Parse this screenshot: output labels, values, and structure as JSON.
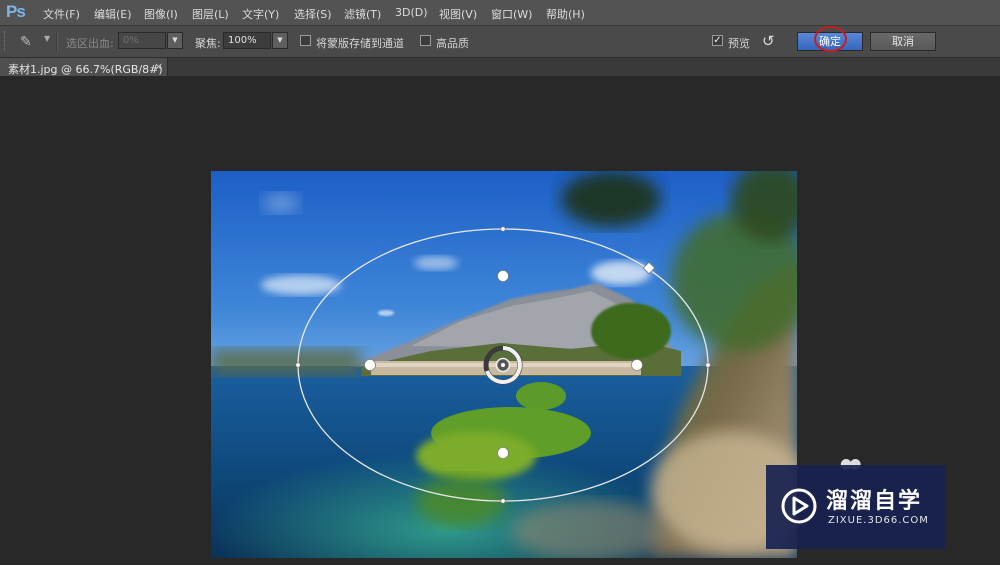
{
  "app": {
    "logo": "Ps"
  },
  "menu": [
    "文件(F)",
    "编辑(E)",
    "图像(I)",
    "图层(L)",
    "文字(Y)",
    "选择(S)",
    "滤镜(T)",
    "3D(D)",
    "视图(V)",
    "窗口(W)",
    "帮助(H)"
  ],
  "options": {
    "selection_bleed_label": "选区出血:",
    "selection_bleed_value": "0%",
    "focus_label": "聚焦:",
    "focus_value": "100%",
    "save_mask_label": "将蒙版存储到通道",
    "high_quality_label": "高品质",
    "preview_label": "预览",
    "preview_checked": "✓",
    "ok_label": "确定",
    "cancel_label": "取消"
  },
  "document_tab": {
    "title": "素材1.jpg @ 66.7%(RGB/8#)",
    "close": "×"
  },
  "watermark": {
    "title": "溜溜自学",
    "url": "ZIXUE.3D66.COM"
  },
  "colors": {
    "accent": "#3466bd",
    "ring": "#c81d1d"
  }
}
